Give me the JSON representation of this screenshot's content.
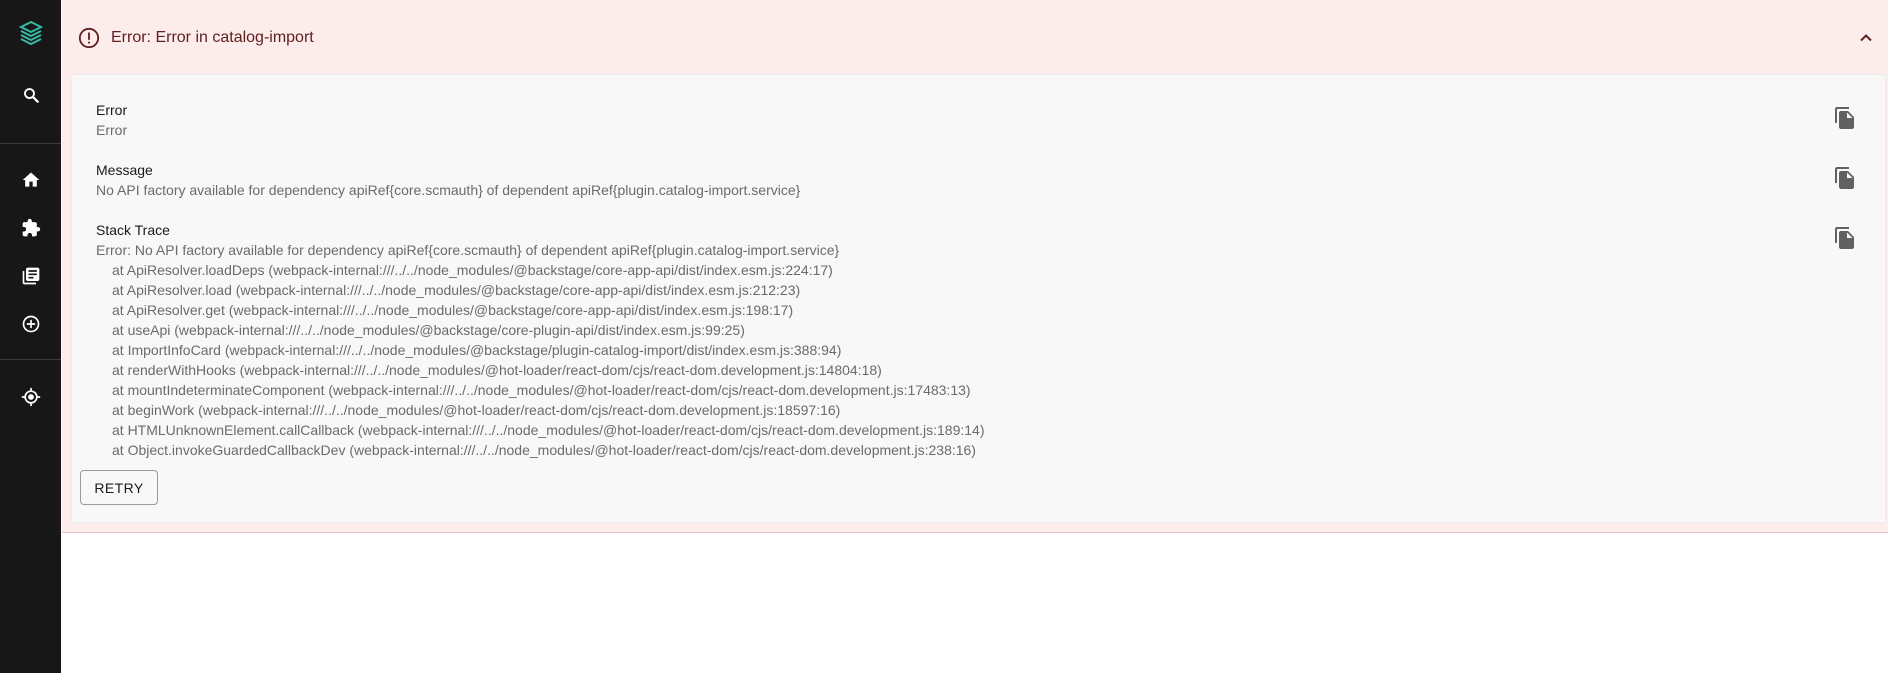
{
  "sidebar": {
    "items": [
      {
        "name": "logo",
        "icon": "backstage-logo-icon"
      },
      {
        "name": "search",
        "icon": "search-icon"
      },
      {
        "name": "home",
        "icon": "home-icon"
      },
      {
        "name": "plugins",
        "icon": "puzzle-icon"
      },
      {
        "name": "docs",
        "icon": "library-books-icon"
      },
      {
        "name": "create",
        "icon": "add-circle-icon"
      },
      {
        "name": "location",
        "icon": "gps-fixed-icon"
      }
    ],
    "accent": "#36baa2"
  },
  "error_panel": {
    "title": "Error: Error in catalog-import",
    "icon": "error-outline-icon",
    "collapse_icon": "chevron-up-icon",
    "background": "#fdecec",
    "title_color": "#5f2120"
  },
  "fields": {
    "error": {
      "label": "Error",
      "value": "Error"
    },
    "message": {
      "label": "Message",
      "value": "No API factory available for dependency apiRef{core.scmauth} of dependent apiRef{plugin.catalog-import.service}"
    },
    "stack_trace": {
      "label": "Stack Trace",
      "first_line": "Error: No API factory available for dependency apiRef{core.scmauth} of dependent apiRef{plugin.catalog-import.service}",
      "lines": [
        "at ApiResolver.loadDeps (webpack-internal:///../../node_modules/@backstage/core-app-api/dist/index.esm.js:224:17)",
        "at ApiResolver.load (webpack-internal:///../../node_modules/@backstage/core-app-api/dist/index.esm.js:212:23)",
        "at ApiResolver.get (webpack-internal:///../../node_modules/@backstage/core-app-api/dist/index.esm.js:198:17)",
        "at useApi (webpack-internal:///../../node_modules/@backstage/core-plugin-api/dist/index.esm.js:99:25)",
        "at ImportInfoCard (webpack-internal:///../../node_modules/@backstage/plugin-catalog-import/dist/index.esm.js:388:94)",
        "at renderWithHooks (webpack-internal:///../../node_modules/@hot-loader/react-dom/cjs/react-dom.development.js:14804:18)",
        "at mountIndeterminateComponent (webpack-internal:///../../node_modules/@hot-loader/react-dom/cjs/react-dom.development.js:17483:13)",
        "at beginWork (webpack-internal:///../../node_modules/@hot-loader/react-dom/cjs/react-dom.development.js:18597:16)",
        "at HTMLUnknownElement.callCallback (webpack-internal:///../../node_modules/@hot-loader/react-dom/cjs/react-dom.development.js:189:14)",
        "at Object.invokeGuardedCallbackDev (webpack-internal:///../../node_modules/@hot-loader/react-dom/cjs/react-dom.development.js:238:16)"
      ]
    }
  },
  "copy_icon": "content-copy-icon",
  "retry_label": "RETRY"
}
